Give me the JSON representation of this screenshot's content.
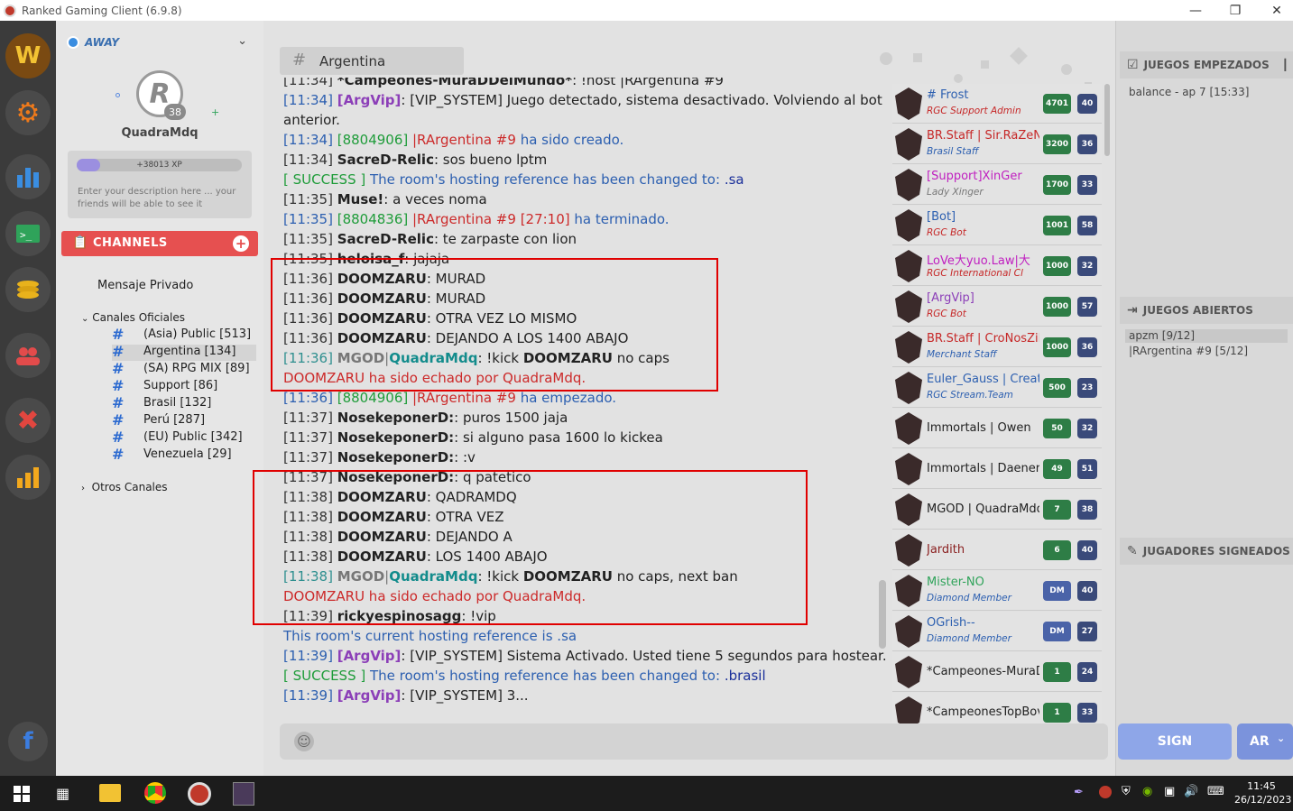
{
  "window": {
    "title": "Ranked Gaming Client (6.9.8)"
  },
  "user": {
    "status": "AWAY",
    "name": "QuadraMdq",
    "level": "38",
    "xp": "+38013 XP",
    "description": "Enter your description here ... your friends will be able to see it"
  },
  "channels": {
    "header": "CHANNELS",
    "private": "Mensaje Privado",
    "official_label": "Canales Oficiales",
    "others_label": "Otros Canales",
    "items": [
      {
        "name": "(Asia) Public [513]"
      },
      {
        "name": "Argentina [134]"
      },
      {
        "name": "(SA) RPG MIX [89]"
      },
      {
        "name": "Support [86]"
      },
      {
        "name": "Brasil [132]"
      },
      {
        "name": "Perú [287]"
      },
      {
        "name": "(EU) Public [342]"
      },
      {
        "name": "Venezuela [29]"
      }
    ]
  },
  "chat": {
    "channel": "Argentina",
    "lines": [
      {
        "ts": "[11:34]",
        "who": "*Campeones-MuraDDelMundo*",
        "text": ": !host |RArgentina #9"
      },
      {
        "ts": "[11:34]",
        "who": "[ArgVip]",
        "text": ": [VIP_SYSTEM] Juego detectado, sistema desactivado. Volviendo al bot"
      },
      {
        "text": "anterior."
      },
      {
        "ts": "[11:34]",
        "who": "[8804906]",
        "text": " |RArgentina #9",
        "tail": " ha sido creado."
      },
      {
        "ts": "[11:34]",
        "who": "SacreD-Relic",
        "text": ": sos bueno lptm"
      },
      {
        "ts": "[ SUCCESS ]",
        "text": " The room's hosting reference has been changed to: ",
        "tail": ".sa"
      },
      {
        "ts": "[11:35]",
        "who": "Muse!",
        "text": ": a veces noma"
      },
      {
        "ts": "[11:35]",
        "who": "[8804836]",
        "text": " |RArgentina #9 [27:10]",
        "tail": " ha terminado."
      },
      {
        "ts": "[11:35]",
        "who": "SacreD-Relic",
        "text": ": te zarpaste con lion"
      },
      {
        "ts": "[11:35]",
        "who": "heloisa_f",
        "text": ": jajaja"
      },
      {
        "ts": "[11:36]",
        "who": "DOOMZARU",
        "text": ": MURAD"
      },
      {
        "ts": "[11:36]",
        "who": "DOOMZARU",
        "text": ": MURAD"
      },
      {
        "ts": "[11:36]",
        "who": "DOOMZARU",
        "text": ": OTRA VEZ LO MISMO"
      },
      {
        "ts": "[11:36]",
        "who": "DOOMZARU",
        "text": ": DEJANDO A LOS 1400 ABAJO"
      },
      {
        "ts": "[11:36]",
        "who": "MGOD",
        "who2": "QuadraMdq",
        "text": ": !kick ",
        "bold": "DOOMZARU",
        "tail": " no caps"
      },
      {
        "text": "DOOMZARU ha sido echado por QuadraMdq."
      },
      {
        "ts": "[11:36]",
        "who": "[8804906]",
        "text": " |RArgentina #9",
        "tail": " ha empezado."
      },
      {
        "ts": "[11:37]",
        "who": "NosekeponerD:",
        "text": ": puros 1500 jaja"
      },
      {
        "ts": "[11:37]",
        "who": "NosekeponerD:",
        "text": ": si alguno pasa 1600 lo kickea"
      },
      {
        "ts": "[11:37]",
        "who": "NosekeponerD:",
        "text": ": :v"
      },
      {
        "ts": "[11:37]",
        "who": "NosekeponerD:",
        "text": ": q patetico"
      },
      {
        "ts": "[11:38]",
        "who": "DOOMZARU",
        "text": ": QADRAMDQ"
      },
      {
        "ts": "[11:38]",
        "who": "DOOMZARU",
        "text": ": OTRA VEZ"
      },
      {
        "ts": "[11:38]",
        "who": "DOOMZARU",
        "text": ": DEJANDO A"
      },
      {
        "ts": "[11:38]",
        "who": "DOOMZARU",
        "text": ": LOS 1400 ABAJO"
      },
      {
        "ts": "[11:38]",
        "who": "MGOD",
        "who2": "QuadraMdq",
        "text": ": !kick ",
        "bold": "DOOMZARU",
        "tail": " no caps, next ban"
      },
      {
        "text": "DOOMZARU ha sido echado por QuadraMdq."
      },
      {
        "ts": "[11:39]",
        "who": "rickyespinosagg",
        "text": ": !vip"
      },
      {
        "text": "This room's current hosting reference is .sa"
      },
      {
        "ts": "[11:39]",
        "who": "[ArgVip]",
        "text": ": [VIP_SYSTEM] Sistema Activado. Usted tiene 5 segundos para hostear..."
      },
      {
        "ts": "[ SUCCESS ]",
        "text": " The room's hosting reference has been changed to: ",
        "tail": ".brasil"
      },
      {
        "ts": "[11:39]",
        "who": "[ArgVip]",
        "text": ": [VIP_SYSTEM] 3..."
      }
    ]
  },
  "users": [
    {
      "name": "# Frost",
      "sub": "RGC Support Admin",
      "pts": "4701",
      "lvl": "40"
    },
    {
      "name": "BR.Staff | Sir.RaZeN",
      "sub": "Brasil Staff",
      "pts": "3200",
      "lvl": "36"
    },
    {
      "name": "[Support]XinGer",
      "sub": "Lady Xinger",
      "pts": "1700",
      "lvl": "33"
    },
    {
      "name": "[Bot]",
      "sub": "RGC Bot",
      "pts": "1001",
      "lvl": "58"
    },
    {
      "name": "LoVe大yuo.Law|大",
      "sub": "RGC International Cl",
      "pts": "1000",
      "lvl": "32"
    },
    {
      "name": "[ArgVip]",
      "sub": "RGC Bot",
      "pts": "1000",
      "lvl": "57"
    },
    {
      "name": "BR.Staff | CroNosZiN",
      "sub": "Merchant Staff",
      "pts": "1000",
      "lvl": "36"
    },
    {
      "name": "Euler_Gauss | Creato",
      "sub": "RGC Stream.Team",
      "pts": "500",
      "lvl": "23"
    },
    {
      "name": "Immortals | Owen",
      "sub": "",
      "pts": "50",
      "lvl": "32"
    },
    {
      "name": "Immortals | Daenerys",
      "sub": "",
      "pts": "49",
      "lvl": "51"
    },
    {
      "name": "MGOD | QuadraMdq",
      "sub": "",
      "pts": "7",
      "lvl": "38"
    },
    {
      "name": "Jardith",
      "sub": "",
      "pts": "6",
      "lvl": "40"
    },
    {
      "name": "Mister-NO",
      "sub": "Diamond Member",
      "pts": "DM",
      "lvl": "40"
    },
    {
      "name": "OGrish--",
      "sub": "Diamond Member",
      "pts": "DM",
      "lvl": "27"
    },
    {
      "name": "*Campeones-MuraDD",
      "sub": "",
      "pts": "1",
      "lvl": "24"
    },
    {
      "name": "*CampeonesTopBov.",
      "sub": "",
      "pts": "1",
      "lvl": "33"
    }
  ],
  "right": {
    "started_title": "JUEGOS EMPEZADOS",
    "started": [
      "balance - ap 7 [15:33]"
    ],
    "open_title": "JUEGOS ABIERTOS",
    "open": [
      "apzm [9/12]",
      "|RArgentina #9 [5/12]"
    ],
    "signed_title": "JUGADORES SIGNEADOS",
    "sign_button": "SIGN",
    "region": "AR"
  },
  "taskbar": {
    "time": "11:45",
    "date": "26/12/2023"
  }
}
